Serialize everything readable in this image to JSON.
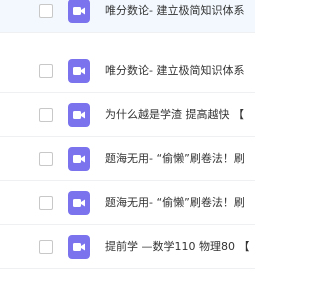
{
  "colors": {
    "video_icon": "#7b73ee",
    "selected_row_bg": "#f2f8fd",
    "row_divider": "#eef0f2",
    "text": "#333333"
  },
  "file_list": {
    "row_icon": "video-file-icon",
    "rows": [
      {
        "title": "唯分数论- 建立极简知识体系",
        "selected": true
      },
      {
        "title": "唯分数论- 建立极简知识体系",
        "selected": false
      },
      {
        "title": "为什么越是学渣 提高越快 【",
        "selected": false
      },
      {
        "title": "题海无用- “偷懒”刷卷法！刷",
        "selected": false
      },
      {
        "title": "题海无用- “偷懒”刷卷法！刷",
        "selected": false
      },
      {
        "title": "提前学 —数学110 物理80 【",
        "selected": false
      }
    ]
  }
}
